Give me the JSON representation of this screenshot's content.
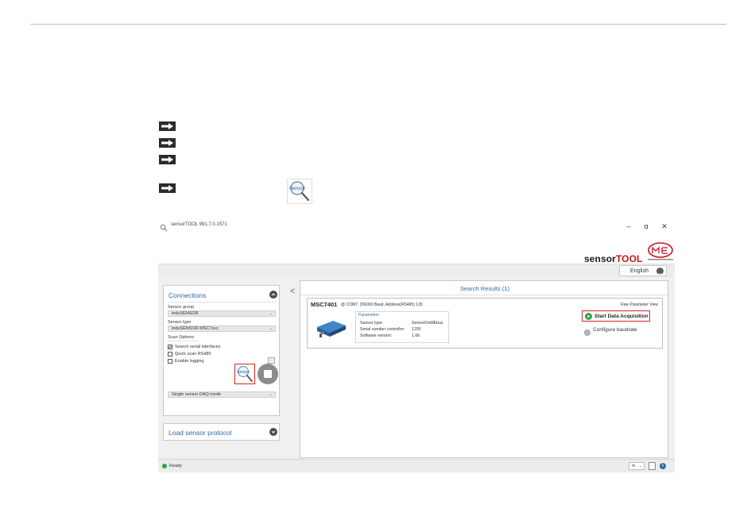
{
  "app": {
    "title": "sensorTOOL 991.7.0.1571",
    "window_controls": {
      "minimize": "–",
      "maximize": "ɑ",
      "close": "✕"
    },
    "brand_sensor": "sensor",
    "brand_tool": "TOOL",
    "language": "English"
  },
  "doc_arrows": [
    "arrow-icon",
    "arrow-icon",
    "arrow-icon",
    "arrow-icon"
  ],
  "connections": {
    "title": "Connections",
    "sensor_group_label": "Sensor group",
    "sensor_group_value": "induSENSOR",
    "sensor_type_label": "Sensor type",
    "sensor_type_value": "induSENSOR MSC7xxx",
    "scan_options_label": "Scan Options",
    "options": [
      {
        "label": "Search serial interfaces",
        "checked": true
      },
      {
        "label": "Quick scan RS485",
        "checked": false
      },
      {
        "label": "Enable logging",
        "checked": false
      }
    ],
    "more_button": "...",
    "scan_icon_text": "Sensor",
    "mode_value": "Single sensor DAQ mode"
  },
  "load_protocol": {
    "title": "Load sensor protocol"
  },
  "collapse_glyph": "<",
  "results": {
    "title": "Search Results (1)",
    "model": "MSC7401",
    "info": "@ COM7, 256000 Baud, Address(RS485) 126",
    "raw_view": "Raw Parameter View",
    "params_title": "Parameters",
    "params": [
      {
        "key": "Sensor type:",
        "value": "SensorOnMEbus"
      },
      {
        "key": "Serial number controller:",
        "value": "1205"
      },
      {
        "key": "Software version:",
        "value": "1.0b"
      }
    ],
    "start_button": "Start Data Acquisition",
    "configure": "Configure baudrate"
  },
  "status": {
    "text": "Ready",
    "unit": "m",
    "colors": {
      "ready": "#2aa24a"
    }
  },
  "colors": {
    "accent_blue": "#2a6aa8",
    "highlight_red": "#d22222",
    "brand_red": "#c4161c"
  }
}
